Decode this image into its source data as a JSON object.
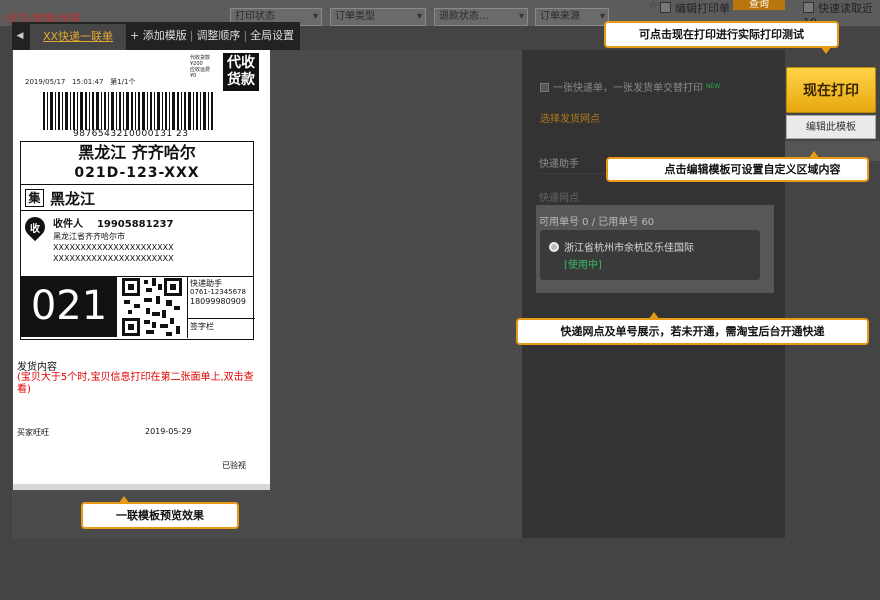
{
  "filters": {
    "breadcrumb": "/宝贝/数量/金额",
    "print_status": "打印状态",
    "order_type": "订单类型",
    "refund_status": "退款状态...",
    "order_source": "订单来源",
    "edit_checkbox": "编辑打印单",
    "search_button": "查询",
    "fast_checkbox": "快速读取近10"
  },
  "tabs": {
    "active": "XX快递一联单",
    "add": "+ 添加模版",
    "reorder": "调整顺序",
    "global": "全局设置"
  },
  "label": {
    "date": "2019/05/17",
    "time": "15:01:47",
    "page": "第1/1个",
    "cod_small_lines": [
      "代收货款",
      "¥200",
      "应收运费",
      "¥0"
    ],
    "cod_big": "代收货款",
    "barcode_number": "9876543210000131 23",
    "province_city": "黑龙江 齐齐哈尔",
    "route_code": "021D-123-XXX",
    "ji_box": "集",
    "ji_text": "黑龙江",
    "pin_text": "收",
    "receiver_label": "收件人",
    "receiver_phone": "19905881237",
    "address_1": "黑龙江省齐齐哈尔市",
    "address_2": "XXXXXXXXXXXXXXXXXXXXXX",
    "address_3": "XXXXXXXXXXXXXXXXXXXXXX",
    "big_code": "021",
    "helper_title": "快递助手",
    "helper_phone_1": "0761-12345678",
    "helper_phone_2": "18099980909",
    "sign_label": "签字栏",
    "goods_title": "发货内容",
    "goods_note": "(宝贝大于5个时,宝贝信息打印在第二张面单上,双击查看)",
    "buyer": "买家旺旺",
    "ship_date": "2019-05-29",
    "checked": "已验视"
  },
  "panel": {
    "option": "一张快递单，一张发货单交替打印",
    "option_badge": "NEW",
    "select_node_link": "选择发货网点",
    "helper_label": "快递助手",
    "node_label": "快递网点",
    "counts": "可用单号 0 / 已用单号 60",
    "node_address": "浙江省杭州市余杭区乐佳国际",
    "node_status": "[使用中]"
  },
  "buttons": {
    "print_now": "现在打印",
    "edit_template": "编辑此模板"
  },
  "callouts": {
    "print_tip": "可点击现在打印进行实际打印测试",
    "edit_tip": "点击编辑模板可设置自定义区域内容",
    "node_tip": "快递网点及单号展示，若未开通，需淘宝后台开通快递",
    "preview_tip": "一联模板预览效果"
  },
  "colors": {
    "accent": "#e79a13",
    "in_use": "#2fbf65",
    "warning_text": "#e10000"
  }
}
